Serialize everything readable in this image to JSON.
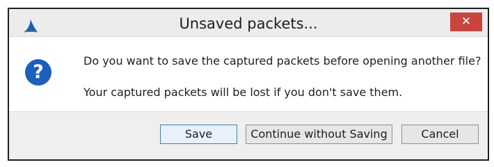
{
  "window": {
    "title": "Unsaved packets...",
    "close_symbol": "✕",
    "app_icon": "wireshark-fin-icon",
    "accent_color": "#1c5fbd",
    "close_color": "#c9443b"
  },
  "dialog": {
    "icon": "question-icon",
    "icon_symbol": "?",
    "message": "Do you want to save the captured packets before opening another file?",
    "detail": "Your captured packets will be lost if you don't save them."
  },
  "buttons": {
    "save": "Save",
    "continue": "Continue without Saving",
    "cancel": "Cancel"
  }
}
